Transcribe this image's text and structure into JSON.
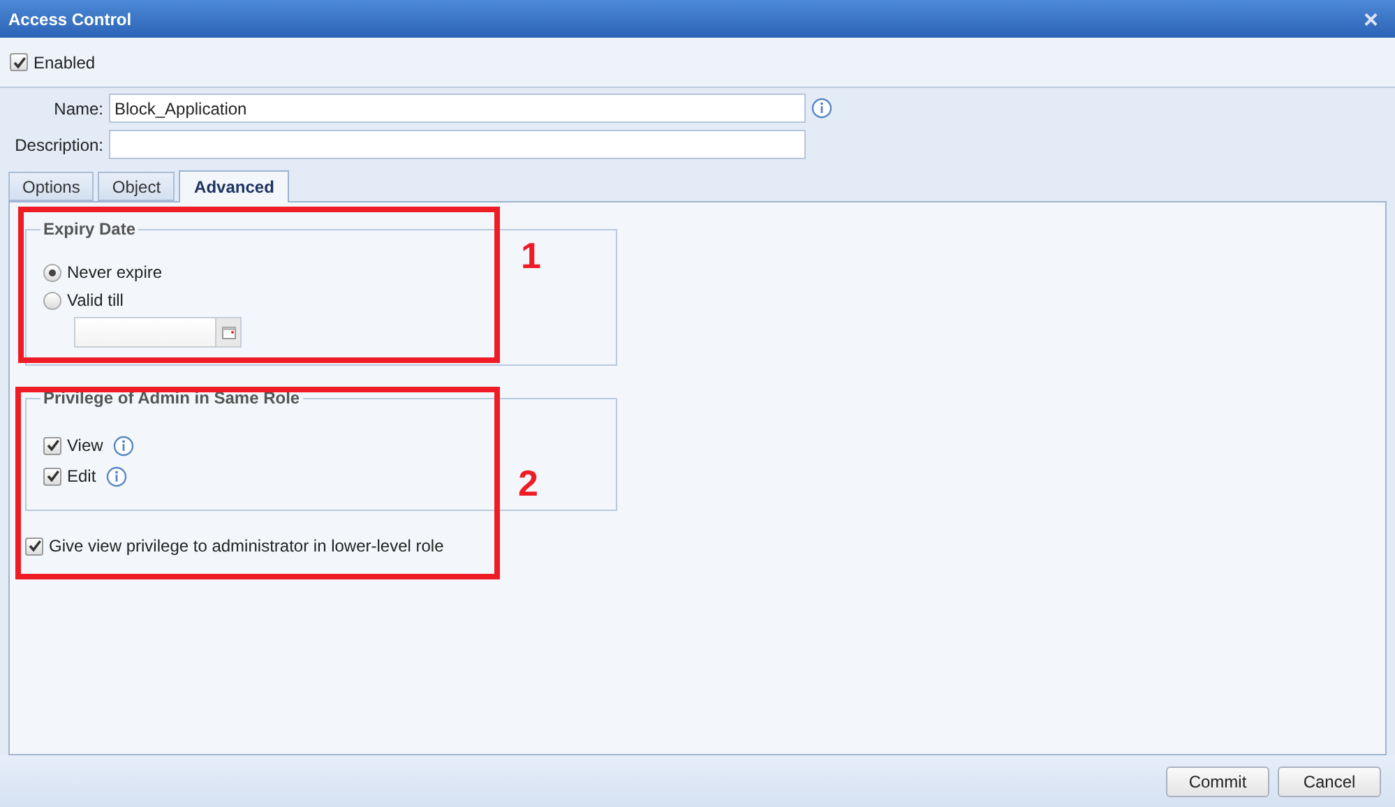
{
  "window": {
    "title": "Access Control",
    "close": "×"
  },
  "enabled": {
    "label": "Enabled",
    "checked": true
  },
  "fields": [
    {
      "label": "Name:",
      "value": "Block_Application"
    },
    {
      "label": "Description:"
    }
  ],
  "tabs": [
    {
      "label": "Options",
      "selected": false
    },
    {
      "label": "Object",
      "selected": false
    },
    {
      "label": "Advanced",
      "selected": true
    }
  ],
  "expiry": {
    "title": "Expiry Date",
    "options": [
      {
        "label": "Never expire",
        "selected": true
      },
      {
        "label": "Valid till",
        "selected": false
      }
    ]
  },
  "privilege": {
    "title": "Privilege of Admin in Same Role",
    "items": [
      {
        "label": "View",
        "checked": true
      },
      {
        "label": "Edit",
        "checked": true
      }
    ]
  },
  "lower_level": {
    "label": "Give view privilege to administrator in lower-level role",
    "checked": true
  },
  "annotations": [
    {
      "label": "1"
    },
    {
      "label": "2"
    }
  ],
  "buttons": [
    "Commit",
    "Cancel"
  ]
}
